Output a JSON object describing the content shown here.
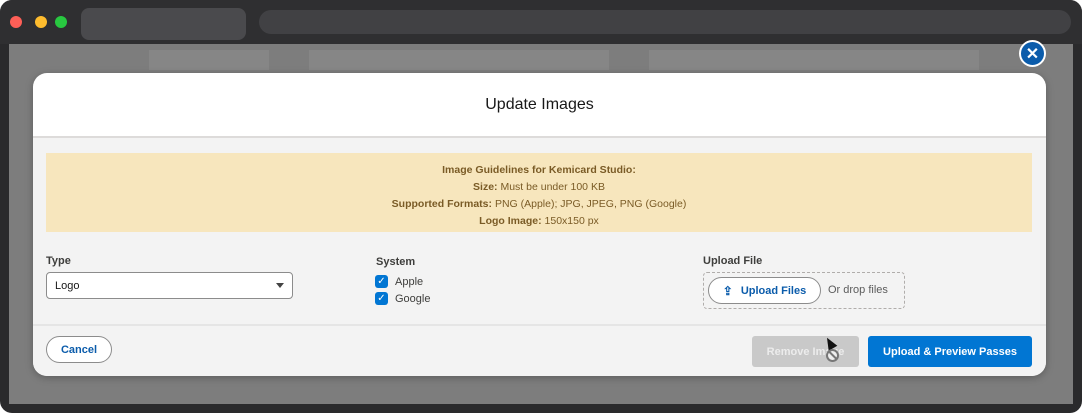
{
  "modal": {
    "title": "Update Images"
  },
  "guidelines": {
    "heading": "Image Guidelines for Kemicard Studio:",
    "size_label": "Size:",
    "size_value": "Must be under 100 KB",
    "formats_label": "Supported Formats:",
    "formats_value": "PNG (Apple); JPG, JPEG, PNG (Google)",
    "logo_label": "Logo Image:",
    "logo_value": "150x150 px"
  },
  "type_field": {
    "label": "Type",
    "value": "Logo"
  },
  "system_field": {
    "label": "System",
    "options": [
      {
        "label": "Apple",
        "checked": true
      },
      {
        "label": "Google",
        "checked": true
      }
    ]
  },
  "upload_field": {
    "label": "Upload File",
    "button_label": "Upload Files",
    "drop_text": "Or drop files"
  },
  "footer": {
    "cancel_label": "Cancel",
    "remove_label": "Remove Image",
    "upload_preview_label": "Upload & Preview Passes"
  },
  "icons": {
    "close": "close-icon",
    "upload": "upload-icon",
    "checkbox": "checkmark-icon",
    "caret": "chevron-down-icon"
  },
  "colors": {
    "brand_blue": "#0176d3",
    "guideline_bg": "#f7e6bd",
    "guideline_text": "#7a5b26"
  }
}
